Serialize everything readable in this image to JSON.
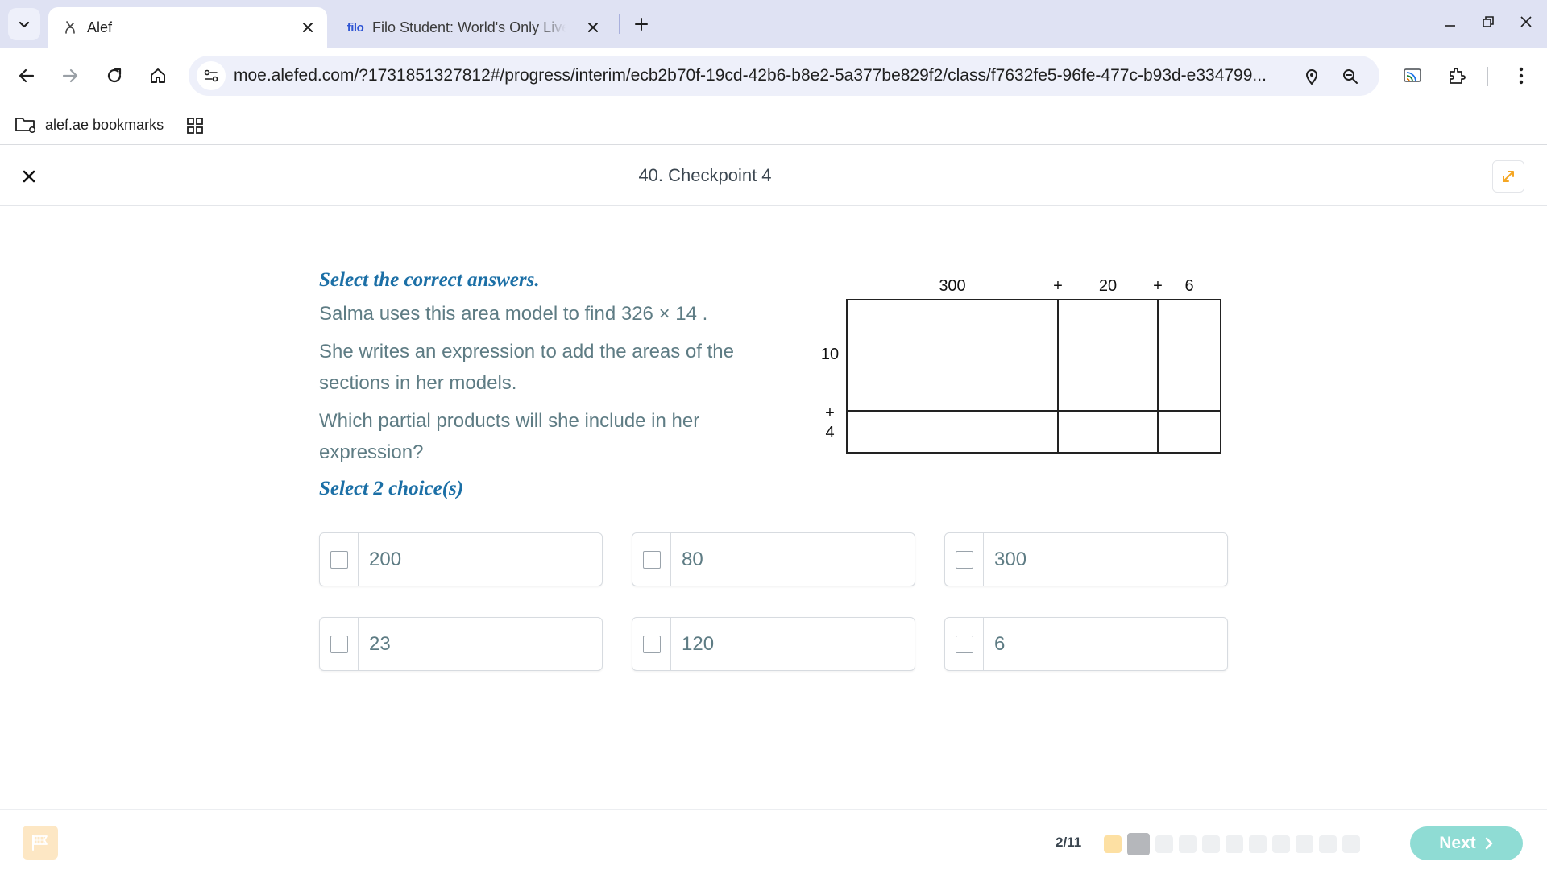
{
  "browser": {
    "tabs": [
      {
        "title": "Alef",
        "active": true
      },
      {
        "title": "Filo Student: World's Only Live Instant Tutoring",
        "favicon_text": "filo",
        "active": false
      }
    ],
    "url": "moe.alefed.com/?1731851327812#/progress/interim/ecb2b70f-19cd-42b6-b8e2-5a377be829f2/class/f7632fe5-96fe-477c-b93d-e334799...",
    "bookmarks": [
      {
        "label": "alef.ae bookmarks"
      }
    ]
  },
  "header": {
    "title": "40. Checkpoint 4"
  },
  "question": {
    "instruction": "Select the correct answers.",
    "line1": "Salma uses this area model to find 326 × 14 .",
    "line2": "She writes an expression to add the areas of the sections in her models.",
    "line3": "Which partial products will she include in her expression?",
    "select_count": "Select 2 choice(s)"
  },
  "area_model": {
    "top_labels": [
      "300",
      "+",
      "20",
      "+",
      "6"
    ],
    "side_labels": [
      "10",
      "+",
      "4"
    ]
  },
  "choices": [
    {
      "value": "200",
      "checked": false
    },
    {
      "value": "80",
      "checked": false
    },
    {
      "value": "300",
      "checked": false
    },
    {
      "value": "23",
      "checked": false
    },
    {
      "value": "120",
      "checked": false
    },
    {
      "value": "6",
      "checked": false
    }
  ],
  "footer": {
    "progress": "2/11",
    "total_questions": 11,
    "current_question": 2,
    "next_label": "Next"
  },
  "colors": {
    "accent_blue": "#1b6fa6",
    "text_gray": "#5e7c84",
    "next_button": "#8fdcd4",
    "flag_button": "#fde7c4",
    "dot_answered": "#fde0a3",
    "dot_current": "#b5b7bb"
  },
  "icons": {
    "tab_list": "chevron-down-icon",
    "alef_favicon": "alef-icon",
    "back": "arrow-left-icon",
    "forward": "arrow-right-icon",
    "reload": "reload-icon",
    "home": "home-icon",
    "location": "location-pin-icon",
    "zoom": "zoom-icon",
    "cast": "cast-icon",
    "extensions": "puzzle-icon",
    "menu": "kebab-menu-icon",
    "flag": "flag-icon",
    "expand": "expand-icon"
  }
}
